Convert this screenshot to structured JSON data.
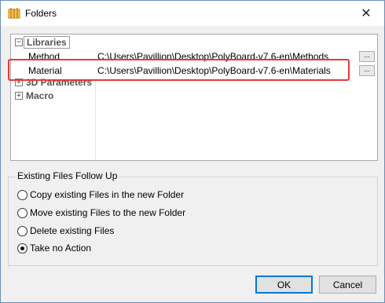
{
  "window": {
    "title": "Folders",
    "close_glyph": "✕"
  },
  "libraries": {
    "category_label": "Libraries",
    "expander": "−",
    "rows": [
      {
        "name": "Method",
        "path": "C:\\Users\\Pavillion\\Desktop\\PolyBoard-v7.6-en\\Methods",
        "button": "..."
      },
      {
        "name": "Material",
        "path": "C:\\Users\\Pavillion\\Desktop\\PolyBoard-v7.6-en\\Materials",
        "button": "..."
      }
    ]
  },
  "parameters_3d": {
    "category_label": "3D Parameters",
    "expander": "+"
  },
  "macro": {
    "category_label": "Macro",
    "expander": "+"
  },
  "follow_up": {
    "label": "Existing Files Follow Up",
    "options": [
      {
        "label": "Copy existing Files in the new Folder",
        "checked": false
      },
      {
        "label": "Move existing Files to the new Folder",
        "checked": false
      },
      {
        "label": "Delete existing Files",
        "checked": false
      },
      {
        "label": "Take no Action",
        "checked": true
      }
    ]
  },
  "buttons": {
    "ok": "OK",
    "cancel": "Cancel"
  },
  "colors": {
    "highlight": "#e8393b",
    "default_button_border": "#0078d7"
  }
}
